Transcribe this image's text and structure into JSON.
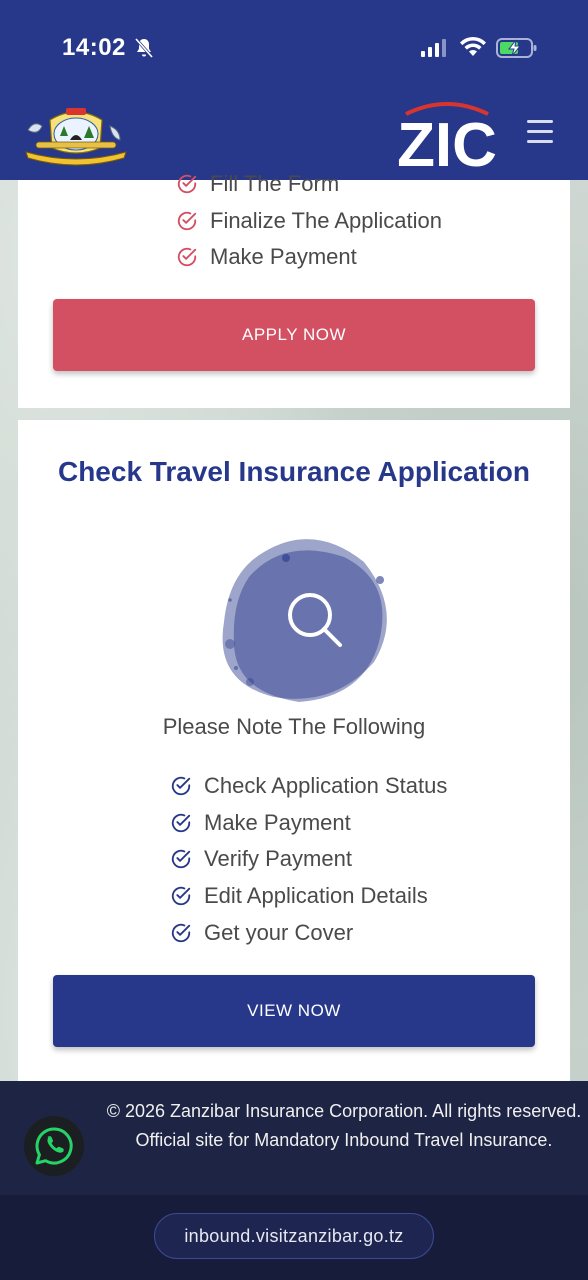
{
  "status_bar": {
    "time": "14:02"
  },
  "header": {
    "brand": "ZIC",
    "menu_icon": "hamburger-icon"
  },
  "apply_card": {
    "steps": [
      "Fill The Form",
      "Finalize The Application",
      "Make Payment"
    ],
    "button_label": "APPLY NOW"
  },
  "check_card": {
    "title": "Check Travel Insurance Application",
    "note": "Please Note The Following",
    "items": [
      "Check Application Status",
      "Make Payment",
      "Verify Payment",
      "Edit Application Details",
      "Get your Cover"
    ],
    "button_label": "VIEW NOW"
  },
  "footer": {
    "text": "© 2026 Zanzibar Insurance Corporation. All rights reserved. Official site for Mandatory Inbound Travel Insurance."
  },
  "browser": {
    "url": "inbound.visitzanzibar.go.tz"
  },
  "colors": {
    "primary": "#27388a",
    "accent": "#d34f62",
    "check_red": "#d34f62",
    "footer_bg": "#1e2444"
  }
}
